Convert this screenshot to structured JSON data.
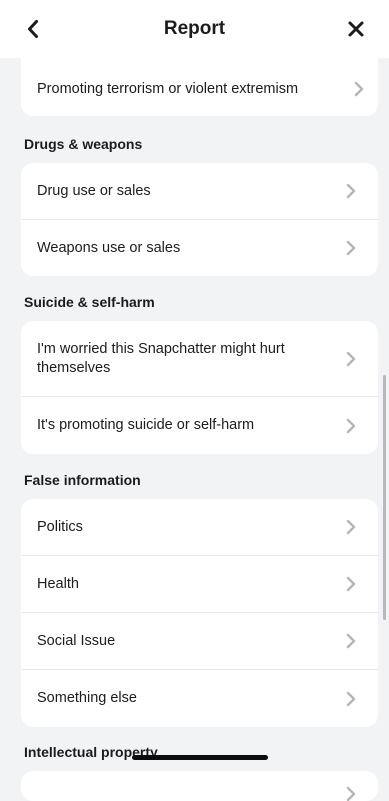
{
  "header": {
    "title": "Report",
    "back_icon": "chevron-left-icon",
    "close_icon": "close-icon"
  },
  "top_card": {
    "items": [
      {
        "label": "Promoting terrorism or violent extremism"
      }
    ]
  },
  "sections": [
    {
      "title": "Drugs & weapons",
      "items": [
        {
          "label": "Drug use or sales"
        },
        {
          "label": "Weapons use or sales"
        }
      ]
    },
    {
      "title": "Suicide & self-harm",
      "items": [
        {
          "label": "I'm worried this Snapchatter might hurt themselves"
        },
        {
          "label": "It's promoting suicide or self-harm"
        }
      ]
    },
    {
      "title": "False information",
      "items": [
        {
          "label": "Politics"
        },
        {
          "label": "Health"
        },
        {
          "label": "Social Issue"
        },
        {
          "label": "Something else"
        }
      ]
    },
    {
      "title": "Intellectual property",
      "items": []
    }
  ],
  "colors": {
    "background": "#f2f3f5",
    "card": "#ffffff",
    "chevron": "#b5b6ba",
    "text": "#1c1c1e"
  }
}
